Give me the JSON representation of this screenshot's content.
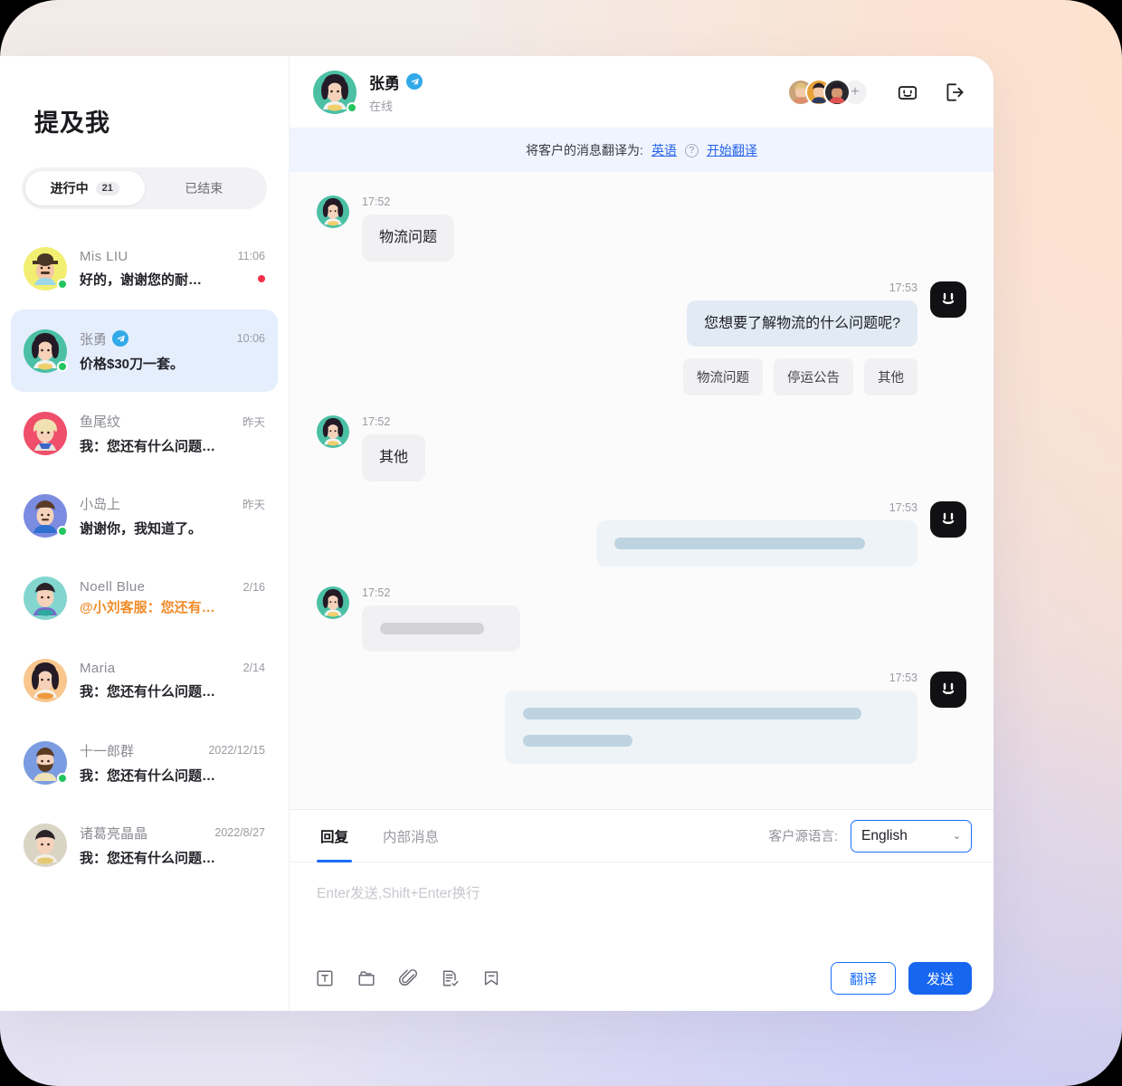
{
  "sidebar": {
    "title": "提及我",
    "tabs": [
      {
        "label": "进行中",
        "count": "21",
        "active": true
      },
      {
        "label": "已结束",
        "count": "",
        "active": false
      }
    ],
    "conversations": [
      {
        "name": "Mis LIU",
        "time": "11:06",
        "preview": "好的，谢谢您的耐…",
        "unread": true,
        "online": true,
        "telegram": false,
        "mention": false,
        "selected": false,
        "latin": true
      },
      {
        "name": "张勇",
        "time": "10:06",
        "preview": "价格$30刀一套。",
        "unread": false,
        "online": true,
        "telegram": true,
        "mention": false,
        "selected": true,
        "latin": false
      },
      {
        "name": "鱼尾纹",
        "time": "昨天",
        "preview": "我：您还有什么问题…",
        "unread": false,
        "online": false,
        "telegram": false,
        "mention": false,
        "selected": false,
        "latin": false
      },
      {
        "name": "小岛上",
        "time": "昨天",
        "preview": "谢谢你，我知道了。",
        "unread": false,
        "online": true,
        "telegram": false,
        "mention": false,
        "selected": false,
        "latin": false
      },
      {
        "name": "Noell Blue",
        "time": "2/16",
        "preview": "@小刘客服：您还有…",
        "unread": false,
        "online": false,
        "telegram": false,
        "mention": true,
        "selected": false,
        "latin": true
      },
      {
        "name": "Maria",
        "time": "2/14",
        "preview": "我：您还有什么问题…",
        "unread": false,
        "online": false,
        "telegram": false,
        "mention": false,
        "selected": false,
        "latin": true
      },
      {
        "name": "十一郎群",
        "time": "2022/12/15",
        "preview": "我：您还有什么问题…",
        "unread": false,
        "online": true,
        "telegram": false,
        "mention": false,
        "selected": false,
        "latin": false
      },
      {
        "name": "诸葛亮晶晶",
        "time": "2022/8/27",
        "preview": "我：您还有什么问题…",
        "unread": false,
        "online": false,
        "telegram": false,
        "mention": false,
        "selected": false,
        "latin": false
      }
    ]
  },
  "chat_header": {
    "name": "张勇",
    "status": "在线",
    "telegram_badge": "telegram-icon",
    "add_label": "+",
    "bot_icon": "robot-icon",
    "logout_icon": "logout-icon"
  },
  "translate_bar": {
    "prefix": "将客户的消息翻译为:",
    "language": "英语",
    "help": "?",
    "action": "开始翻译"
  },
  "messages": [
    {
      "id": "m1",
      "side": "in",
      "time": "17:52",
      "type": "text",
      "text": "物流问题"
    },
    {
      "id": "m2",
      "side": "out",
      "time": "17:53",
      "type": "text",
      "text": "您想要了解物流的什么问题呢?",
      "chips": [
        "物流问题",
        "停运公告",
        "其他"
      ]
    },
    {
      "id": "m3",
      "side": "in",
      "time": "17:52",
      "type": "text",
      "text": "其他"
    },
    {
      "id": "m4",
      "side": "out",
      "time": "17:53",
      "type": "skeleton",
      "bars": [
        100
      ]
    },
    {
      "id": "m5",
      "side": "in",
      "time": "17:52",
      "type": "skeleton",
      "bars": [
        87
      ],
      "tone": "grey"
    },
    {
      "id": "m6",
      "side": "out",
      "time": "17:53",
      "type": "skeleton",
      "bars": [
        91,
        28
      ]
    }
  ],
  "composer": {
    "tabs": [
      {
        "label": "回复",
        "active": true
      },
      {
        "label": "内部消息",
        "active": false
      }
    ],
    "lang_label": "客户源语言:",
    "lang_value": "English",
    "caret": "⌄",
    "placeholder": "Enter发送,Shift+Enter换行",
    "editor_value": "",
    "tools": [
      "text-format-icon",
      "folder-icon",
      "attachment-icon",
      "quick-reply-icon",
      "bookmark-icon"
    ],
    "translate_button": "翻译",
    "send_button": "发送"
  },
  "theme": {
    "accent": "#1766f0",
    "selected_row": "#e5eefd",
    "translate_bar_bg": "#eff4fe",
    "mention": "#f08c2b",
    "unread": "#f4334a",
    "online": "#22c55e"
  }
}
